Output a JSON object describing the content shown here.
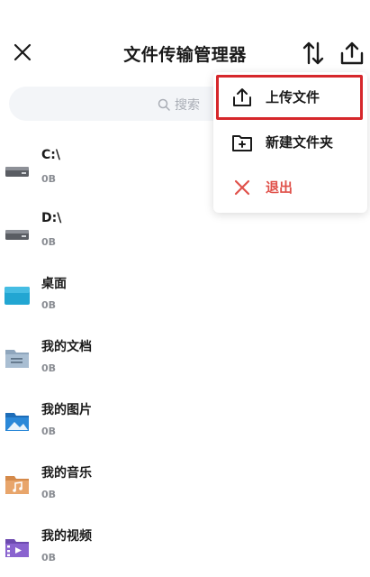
{
  "header": {
    "title": "文件传输管理器"
  },
  "search": {
    "placeholder": "搜索"
  },
  "files": [
    {
      "name": "C:\\",
      "size": "0B",
      "icon": "drive-icon"
    },
    {
      "name": "D:\\",
      "size": "0B",
      "icon": "drive-icon"
    },
    {
      "name": "桌面",
      "size": "0B",
      "icon": "desktop-folder-icon"
    },
    {
      "name": "我的文档",
      "size": "0B",
      "icon": "documents-folder-icon"
    },
    {
      "name": "我的图片",
      "size": "0B",
      "icon": "pictures-folder-icon"
    },
    {
      "name": "我的音乐",
      "size": "0B",
      "icon": "music-folder-icon"
    },
    {
      "name": "我的视频",
      "size": "0B",
      "icon": "videos-folder-icon"
    }
  ],
  "menu": {
    "items": [
      {
        "label": "上传文件",
        "icon": "upload-icon",
        "highlighted": true
      },
      {
        "label": "新建文件夹",
        "icon": "new-folder-icon"
      },
      {
        "label": "退出",
        "icon": "close-icon"
      }
    ]
  },
  "colors": {
    "accent_highlight": "#d6272b",
    "exit_red": "#e0514a",
    "search_bg": "#f3f5f8",
    "secondary_text": "#8a8d93"
  }
}
